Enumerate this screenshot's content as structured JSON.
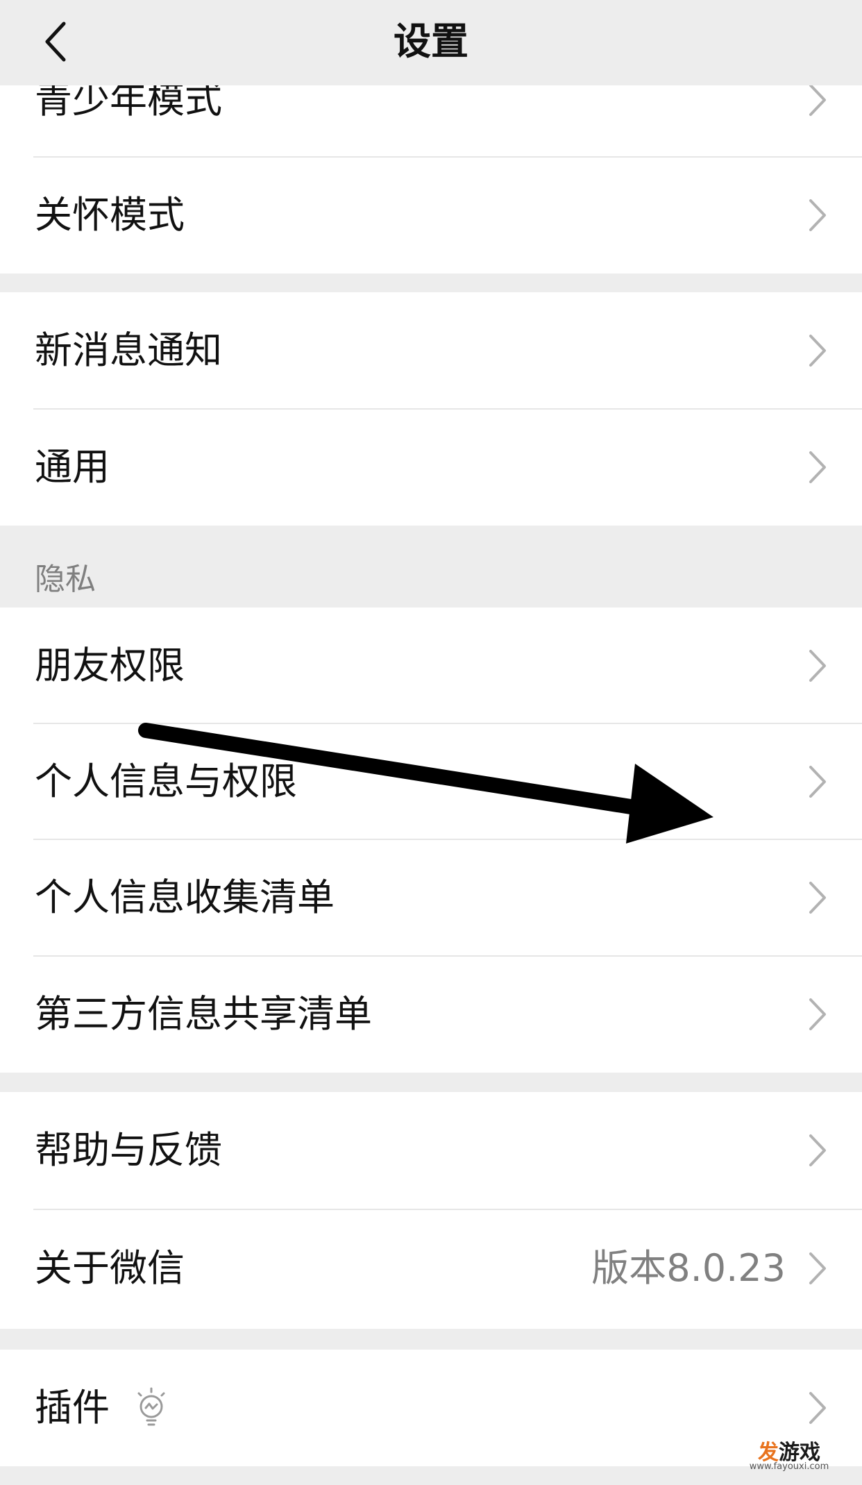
{
  "header": {
    "title": "设置",
    "back_icon": "chevron-left-icon"
  },
  "groups": {
    "modes": {
      "items": [
        {
          "label": "青少年模式"
        },
        {
          "label": "关怀模式"
        }
      ]
    },
    "general": {
      "items": [
        {
          "label": "新消息通知"
        },
        {
          "label": "通用"
        }
      ]
    },
    "privacy": {
      "section_title": "隐私",
      "items": [
        {
          "label": "朋友权限"
        },
        {
          "label": "个人信息与权限"
        },
        {
          "label": "个人信息收集清单"
        },
        {
          "label": "第三方信息共享清单"
        }
      ]
    },
    "about": {
      "items": [
        {
          "label": "帮助与反馈"
        },
        {
          "label": "关于微信",
          "value": "版本8.0.23"
        }
      ]
    },
    "plugins": {
      "items": [
        {
          "label": "插件",
          "icon": "lightbulb-icon"
        }
      ]
    }
  },
  "annotation": {
    "icon": "arrow-annotation-icon",
    "color": "#000000"
  },
  "watermark": {
    "logo_first": "发",
    "logo_rest": "游戏",
    "url": "www.fayouxi.com"
  },
  "colors": {
    "background": "#ededed",
    "card": "#ffffff",
    "text": "#111111",
    "secondary_text": "#808080",
    "chevron": "#b2b2b2"
  }
}
